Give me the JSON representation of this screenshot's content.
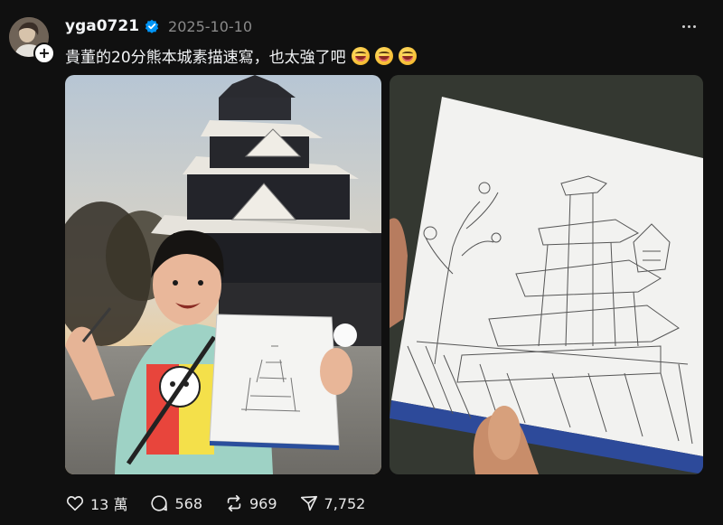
{
  "post": {
    "username": "yga0721",
    "date": "2025-10-10",
    "caption": "貴董的20分熊本城素描速寫，也太強了吧",
    "caption_emojis": [
      "grinning-tongue-emoji",
      "grinning-tongue-emoji",
      "grinning-tongue-emoji"
    ]
  },
  "avatar": {
    "follow_symbol": "+"
  },
  "media": [
    {
      "name": "kumamoto-castle-photo",
      "description_icon": "photo"
    },
    {
      "name": "castle-sketch-photo",
      "description_icon": "photo"
    }
  ],
  "actions": {
    "likes": "13 萬",
    "replies": "568",
    "reposts": "969",
    "shares": "7,752"
  },
  "icons": {
    "verified": "verified-badge-icon",
    "more": "more-icon",
    "like": "heart-icon",
    "reply": "comment-icon",
    "repost": "repost-icon",
    "share": "send-icon"
  },
  "colors": {
    "background": "#101010",
    "text": "#f3f5f7",
    "muted": "#8a8a8a",
    "verified": "#0095f6"
  }
}
